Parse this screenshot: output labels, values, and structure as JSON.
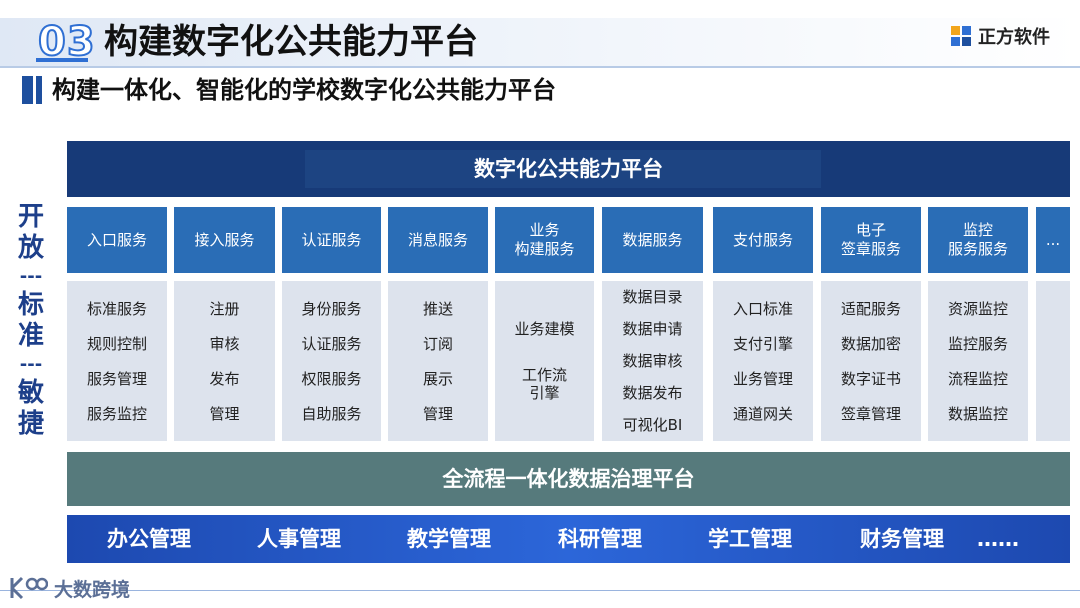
{
  "header": {
    "section_number": "03",
    "title": "构建数字化公共能力平台",
    "brand": "正方软件",
    "subtitle": "构建一体化、智能化的学校数字化公共能力平台"
  },
  "side_label": {
    "lines": [
      "开",
      "放",
      "---",
      "标",
      "准",
      "---",
      "敏",
      "捷"
    ]
  },
  "platform_title": "数字化公共能力平台",
  "services": [
    {
      "name": "入口服务",
      "items": [
        "标准服务",
        "规则控制",
        "服务管理",
        "服务监控"
      ]
    },
    {
      "name": "接入服务",
      "items": [
        "注册",
        "审核",
        "发布",
        "管理"
      ]
    },
    {
      "name": "认证服务",
      "items": [
        "身份服务",
        "认证服务",
        "权限服务",
        "自助服务"
      ]
    },
    {
      "name": "消息服务",
      "items": [
        "推送",
        "订阅",
        "展示",
        "管理"
      ]
    },
    {
      "name": "业务\n构建服务",
      "items": [
        "业务建模",
        "工作流\n引擎"
      ]
    },
    {
      "name": "数据服务",
      "items": [
        "数据目录",
        "数据申请",
        "数据审核",
        "数据发布",
        "可视化BI"
      ]
    },
    {
      "name": "支付服务",
      "items": [
        "入口标准",
        "支付引擎",
        "业务管理",
        "通道网关"
      ]
    },
    {
      "name": "电子\n签章服务",
      "items": [
        "适配服务",
        "数据加密",
        "数字证书",
        "签章管理"
      ]
    },
    {
      "name": "监控\n服务服务",
      "items": [
        "资源监控",
        "监控服务",
        "流程监控",
        "数据监控"
      ]
    },
    {
      "name": "...",
      "items": []
    }
  ],
  "governance_title": "全流程一体化数据治理平台",
  "management": [
    "办公管理",
    "人事管理",
    "教学管理",
    "科研管理",
    "学工管理",
    "财务管理",
    "……"
  ],
  "footer": {
    "brand": "大数跨境"
  },
  "colors": {
    "platform": "#173a78",
    "service_header": "#2a6db6",
    "service_body": "#dde3ed",
    "governance": "#567a7c",
    "management": "#2c66d9",
    "side_text": "#1d3f8a"
  }
}
